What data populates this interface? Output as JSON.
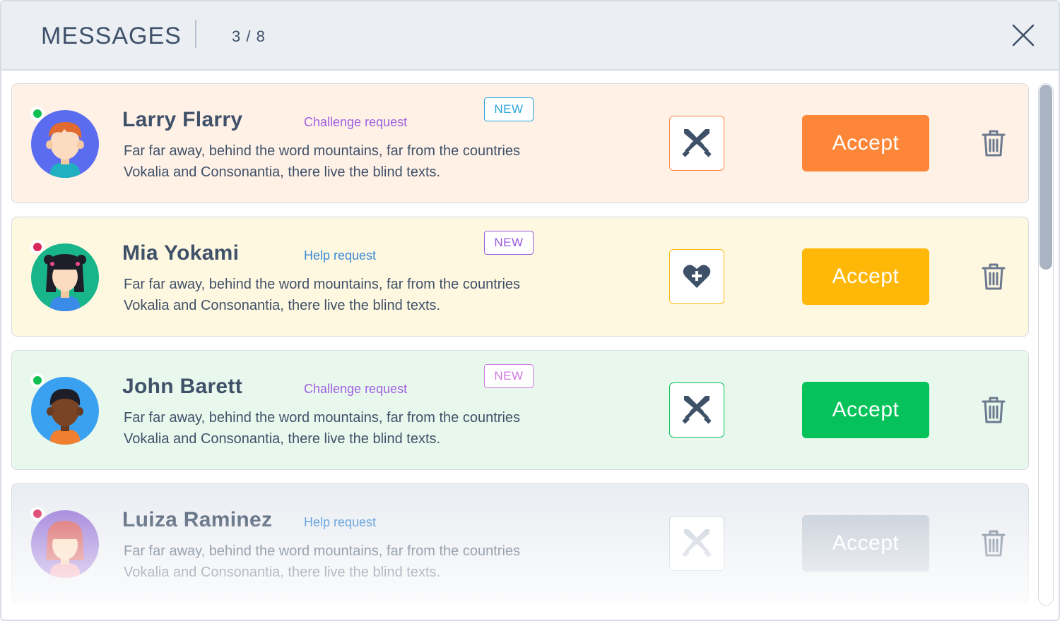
{
  "header": {
    "title": "MESSAGES",
    "counter": "3 / 8",
    "close_icon": "close-icon"
  },
  "messages": [
    {
      "name": "Larry Flarry",
      "request": "Challenge request",
      "badge": "NEW",
      "text": "Far far away, behind the word mountains, far from the countries Vokalia and Consonantia, there live the blind texts.",
      "accept_label": "Accept",
      "status": "online",
      "action_icon": "swords-icon",
      "colors": {
        "card": "#fff1e6",
        "accent": "#fe8638",
        "request": "#a060e0",
        "badge": "#2aa5d8",
        "status": "#10c050"
      }
    },
    {
      "name": "Mia Yokami",
      "request": "Help request",
      "badge": "NEW",
      "text": "Far far away, behind the word mountains, far from the countries Vokalia and Consonantia, there live the blind texts.",
      "accept_label": "Accept",
      "status": "busy",
      "action_icon": "heart-plus-icon",
      "colors": {
        "card": "#fff8e0",
        "accent": "#ffb808",
        "request": "#3a8ad8",
        "badge": "#9a5ad8",
        "status": "#d8285a"
      }
    },
    {
      "name": "John Barett",
      "request": "Challenge request",
      "badge": "NEW",
      "text": "Far far away, behind the word mountains, far from the countries Vokalia and Consonantia, there live the blind texts.",
      "accept_label": "Accept",
      "status": "online",
      "action_icon": "swords-icon",
      "colors": {
        "card": "#e9f8ed",
        "accent": "#05c35a",
        "request": "#a060e0",
        "badge": "#d07ae0",
        "status": "#10c050"
      }
    },
    {
      "name": "Luiza Raminez",
      "request": "Help request",
      "text": "Far far away, behind the word mountains, far from the countries Vokalia and Consonantia, there live the blind texts.",
      "accept_label": "Accept",
      "status": "busy",
      "action_icon": "swords-icon",
      "colors": {
        "card": "#eaedf2",
        "accent": "#c3cbd6",
        "request": "#3a8ad8",
        "status": "#d8285a"
      }
    }
  ]
}
